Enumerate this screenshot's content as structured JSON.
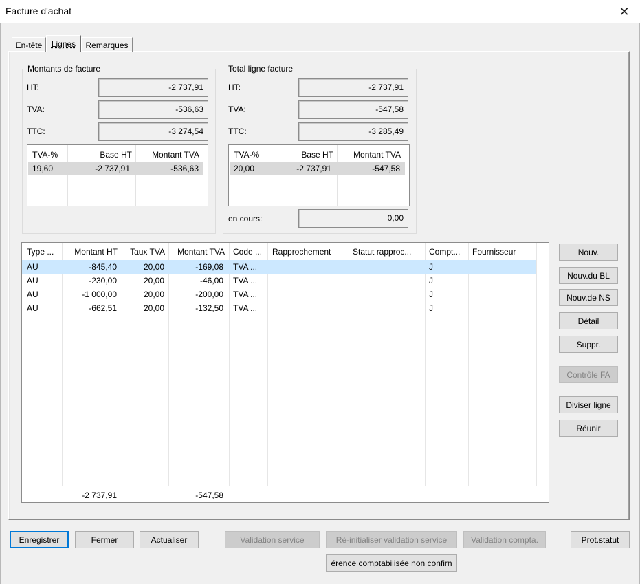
{
  "window": {
    "title": "Facture d'achat",
    "close_glyph": "✕"
  },
  "tabs": [
    {
      "label": "En-tête"
    },
    {
      "label": "Lignes"
    },
    {
      "label": "Remarques"
    }
  ],
  "invoice_amounts": {
    "title": "Montants de facture",
    "ht_label": "HT:",
    "ht_value": "-2 737,91",
    "tva_label": "TVA:",
    "tva_value": "-536,63",
    "ttc_label": "TTC:",
    "ttc_value": "-3 274,54",
    "table": {
      "headers": [
        "TVA-%",
        "Base HT",
        "Montant TVA"
      ],
      "rows": [
        [
          "19,60",
          "-2 737,91",
          "-536,63"
        ]
      ]
    }
  },
  "line_totals": {
    "title": "Total ligne facture",
    "ht_label": "HT:",
    "ht_value": "-2 737,91",
    "tva_label": "TVA:",
    "tva_value": "-547,58",
    "ttc_label": "TTC:",
    "ttc_value": "-3 285,49",
    "table": {
      "headers": [
        "TVA-%",
        "Base HT",
        "Montant TVA"
      ],
      "rows": [
        [
          "20,00",
          "-2 737,91",
          "-547,58"
        ]
      ]
    },
    "pending_label": "en cours:",
    "pending_value": "0,00"
  },
  "lines_grid": {
    "headers": [
      "Type ...",
      "Montant HT",
      "Taux TVA",
      "Montant TVA",
      "Code ...",
      "Rapprochement",
      "Statut rapproc...",
      "Compt...",
      "Fournisseur"
    ],
    "rows": [
      [
        "AU",
        "-845,40",
        "20,00",
        "-169,08",
        "TVA ...",
        "",
        "",
        "J",
        ""
      ],
      [
        "AU",
        "-230,00",
        "20,00",
        "-46,00",
        "TVA ...",
        "",
        "",
        "J",
        ""
      ],
      [
        "AU",
        "-1 000,00",
        "20,00",
        "-200,00",
        "TVA ...",
        "",
        "",
        "J",
        ""
      ],
      [
        "AU",
        "-662,51",
        "20,00",
        "-132,50",
        "TVA ...",
        "",
        "",
        "J",
        ""
      ]
    ],
    "footer": {
      "montant_ht": "-2 737,91",
      "montant_tva": "-547,58"
    }
  },
  "side_buttons": {
    "new": "Nouv.",
    "new_bl": "Nouv.du BL",
    "new_ns": "Nouv.de NS",
    "detail": "Détail",
    "delete": "Suppr.",
    "control_fa": "Contrôle FA",
    "split_line": "Diviser ligne",
    "merge": "Réunir"
  },
  "bottom_buttons": {
    "save": "Enregistrer",
    "close": "Fermer",
    "refresh": "Actualiser",
    "validate_service": "Validation service",
    "reset_validation": "Ré-initialiser validation service",
    "validate_accounting": "Validation compta.",
    "status_log": "Prot.statut",
    "difference": "érence comptabilisée non confirn"
  }
}
